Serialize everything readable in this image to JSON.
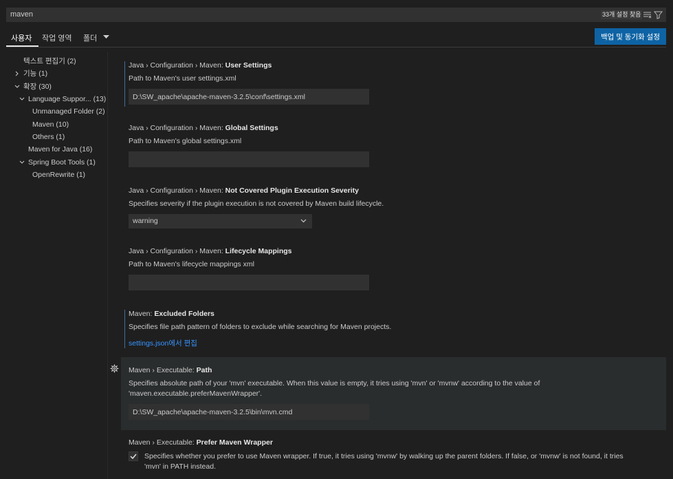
{
  "search": {
    "value": "maven",
    "result_count": "33개 설정 찾음",
    "clear_icon": "clear-filter-icon",
    "filter_icon": "filter-icon"
  },
  "tabs": [
    {
      "label": "사용자"
    },
    {
      "label": "작업 영역"
    },
    {
      "label": "폴더"
    }
  ],
  "sync_button": "백업 및 동기화 설정",
  "toc": [
    {
      "label": "텍스트 편집기 (2)"
    },
    {
      "label": "기능 (1)"
    },
    {
      "label": "확장 (30)"
    },
    {
      "label": "Language Suppor... (13)"
    },
    {
      "label": "Unmanaged Folder (2)"
    },
    {
      "label": "Maven (10)"
    },
    {
      "label": "Others (1)"
    },
    {
      "label": "Maven for Java (16)"
    },
    {
      "label": "Spring Boot Tools (1)"
    },
    {
      "label": "OpenRewrite (1)"
    }
  ],
  "settings": {
    "user_settings": {
      "prefix": "Java › Configuration › Maven: ",
      "name": "User Settings",
      "desc": "Path to Maven's user settings.xml",
      "value": "D:\\SW_apache\\apache-maven-3.2.5\\conf\\settings.xml"
    },
    "global_settings": {
      "prefix": "Java › Configuration › Maven: ",
      "name": "Global Settings",
      "desc": "Path to Maven's global settings.xml",
      "value": ""
    },
    "severity": {
      "prefix": "Java › Configuration › Maven: ",
      "name": "Not Covered Plugin Execution Severity",
      "desc": "Specifies severity if the plugin execution is not covered by Maven build lifecycle.",
      "value": "warning"
    },
    "lifecycle": {
      "prefix": "Java › Configuration › Maven: ",
      "name": "Lifecycle Mappings",
      "desc": "Path to Maven's lifecycle mappings xml",
      "value": ""
    },
    "excluded": {
      "prefix": "Maven: ",
      "name": "Excluded Folders",
      "desc": "Specifies file path pattern of folders to exclude while searching for Maven projects.",
      "link": "settings.json에서 편집"
    },
    "exec_path": {
      "prefix": "Maven › Executable: ",
      "name": "Path",
      "desc_line1": "Specifies absolute path of your 'mvn' executable. When this value is empty, it tries using 'mvn' or 'mvnw' according to the value of",
      "desc_line2": "'maven.executable.preferMavenWrapper'.",
      "value": "D:\\SW_apache\\apache-maven-3.2.5\\bin\\mvn.cmd"
    },
    "wrapper": {
      "prefix": "Maven › Executable: ",
      "name": "Prefer Maven Wrapper",
      "desc_line1": "Specifies whether you prefer to use Maven wrapper. If true, it tries using 'mvnw' by walking up the parent folders. If false, or 'mvnw' is not found, it tries",
      "desc_line2": "'mvn' in PATH instead.",
      "checked": true
    }
  },
  "colors": {
    "background": "#1f1f1f",
    "accent_button": "#0e63a4",
    "link": "#3794ff",
    "modified_indicator": "#3f6fa0"
  }
}
